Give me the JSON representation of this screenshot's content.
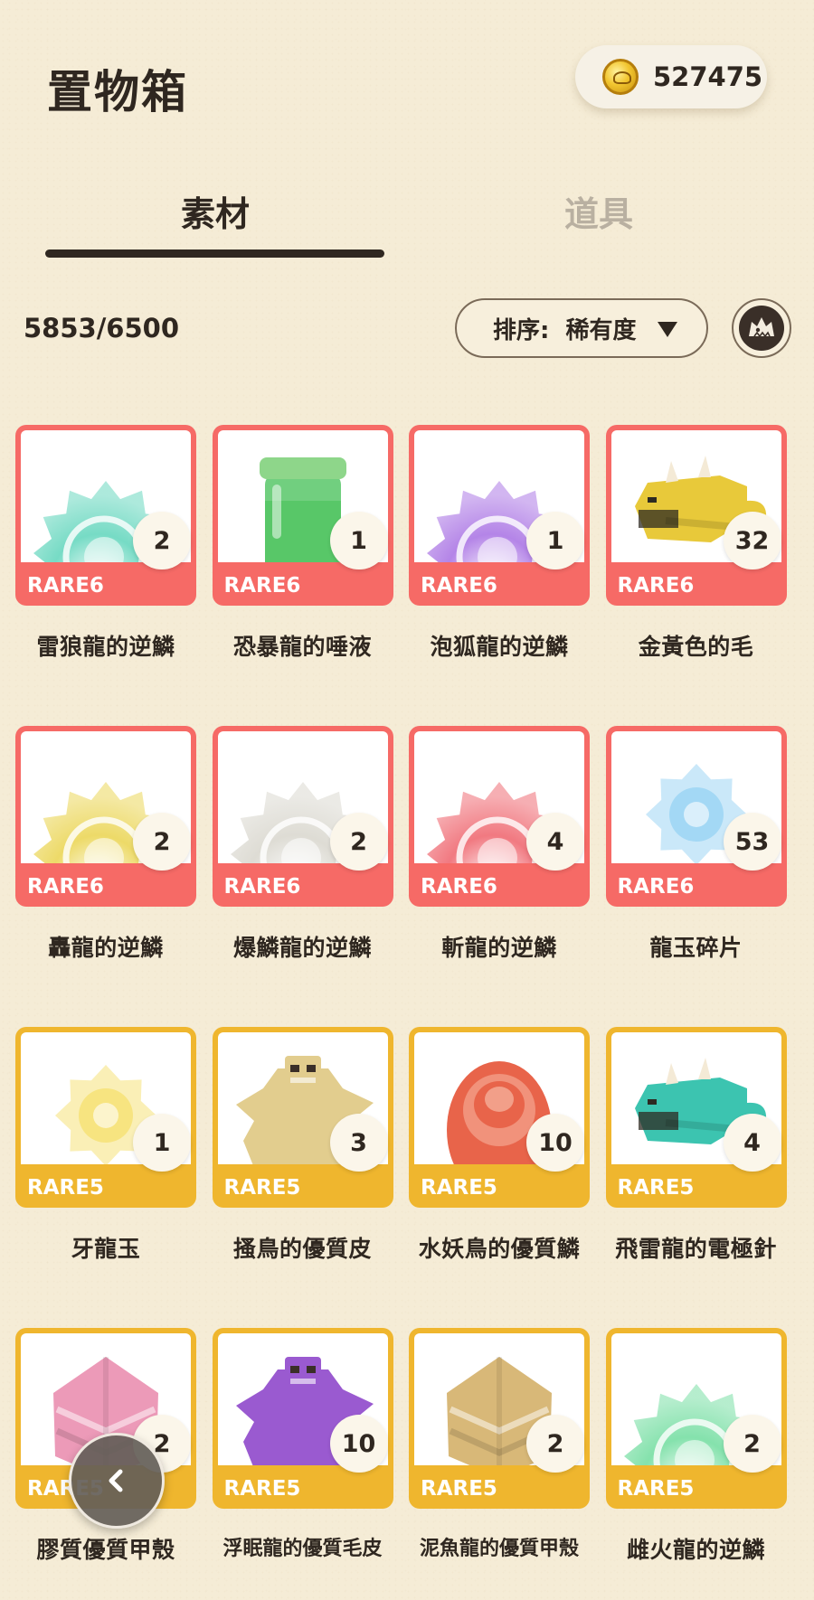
{
  "header": {
    "title": "置物箱",
    "coin_icon": "gold-coin-icon",
    "coins": "527475"
  },
  "tabs": [
    {
      "label": "素材",
      "active": true
    },
    {
      "label": "道具",
      "active": false
    }
  ],
  "toolbar": {
    "count": "5853/6500",
    "sort_label": "排序:  稀有度",
    "filter_icon": "monster-filter-icon"
  },
  "colors": {
    "rare6": "#f66a66",
    "rare5": "#efb62e",
    "background": "#f5ecd6",
    "text": "#2f2720"
  },
  "items": [
    {
      "name": "雷狼龍的逆鱗",
      "rarity": "RARE6",
      "qty": "2",
      "icon": "scale-icon",
      "color": "#6fd9c2"
    },
    {
      "name": "恐暴龍的唾液",
      "rarity": "RARE6",
      "qty": "1",
      "icon": "jar-icon",
      "color": "#58c768"
    },
    {
      "name": "泡狐龍的逆鱗",
      "rarity": "RARE6",
      "qty": "1",
      "icon": "scale-icon",
      "color": "#b07ee6"
    },
    {
      "name": "金黃色的毛",
      "rarity": "RARE6",
      "qty": "32",
      "icon": "monster-head-icon",
      "color": "#e8c93a"
    },
    {
      "name": "轟龍的逆鱗",
      "rarity": "RARE6",
      "qty": "2",
      "icon": "scale-icon",
      "color": "#ecd860"
    },
    {
      "name": "爆鱗龍的逆鱗",
      "rarity": "RARE6",
      "qty": "2",
      "icon": "scale-icon",
      "color": "#dcdad2"
    },
    {
      "name": "斬龍的逆鱗",
      "rarity": "RARE6",
      "qty": "4",
      "icon": "scale-icon",
      "color": "#f0727a"
    },
    {
      "name": "龍玉碎片",
      "rarity": "RARE6",
      "qty": "53",
      "icon": "gem-icon",
      "color": "#9fd6f4"
    },
    {
      "name": "牙龍玉",
      "rarity": "RARE5",
      "qty": "1",
      "icon": "gem-icon",
      "color": "#f6e27a"
    },
    {
      "name": "搔鳥的優質皮",
      "rarity": "RARE5",
      "qty": "3",
      "icon": "pelt-icon",
      "color": "#e2cd8e"
    },
    {
      "name": "水妖鳥的優質鱗",
      "rarity": "RARE5",
      "qty": "10",
      "icon": "shell-icon",
      "color": "#e8644a"
    },
    {
      "name": "飛雷龍的電極針",
      "rarity": "RARE5",
      "qty": "4",
      "icon": "monster-head-icon",
      "color": "#3cc4b0"
    },
    {
      "name": "膠質優質甲殼",
      "rarity": "RARE5",
      "qty": "2",
      "icon": "carapace-icon",
      "color": "#ec9ab8"
    },
    {
      "name": "浮眠龍的優質毛皮",
      "rarity": "RARE5",
      "qty": "10",
      "icon": "pelt-icon",
      "color": "#9a5ad0"
    },
    {
      "name": "泥魚龍的優質甲殼",
      "rarity": "RARE5",
      "qty": "2",
      "icon": "carapace-icon",
      "color": "#d8b878"
    },
    {
      "name": "雌火龍的逆鱗",
      "rarity": "RARE5",
      "qty": "2",
      "icon": "scale-icon",
      "color": "#7ee0a8"
    }
  ],
  "nav": {
    "back_icon": "chevron-left-icon"
  }
}
